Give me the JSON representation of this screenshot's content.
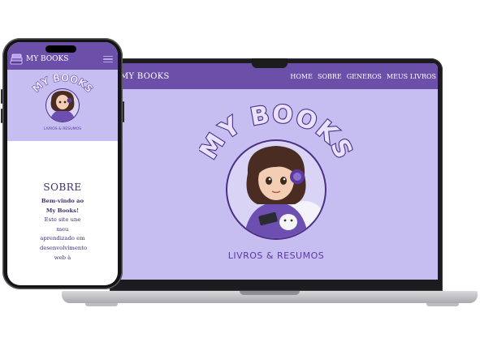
{
  "laptop": {
    "nav": {
      "brand": "MY BOOKS",
      "links": [
        "HOME",
        "SOBRE",
        "GENEROS",
        "MEUS LIVROS"
      ]
    },
    "hero": {
      "logo_title": "MY BOOKS",
      "logo_subtitle": "LIVROS & RESUMOS"
    }
  },
  "phone": {
    "nav": {
      "brand": "MY BOOKS",
      "menu_icon": "hamburger-menu-icon"
    },
    "hero": {
      "logo_title": "MY BOOKS",
      "logo_subtitle": "LIVROS & RESUMOS"
    },
    "about": {
      "title": "SOBRE",
      "text_bold": "Bem-vindo ao My Books!",
      "text": "Este site une meu aprendizado em desenvolvimento web à"
    }
  },
  "colors": {
    "nav_purple": "#6b4fa8",
    "hero_lavender": "#c6bdf0",
    "logo_text": "#e8e2ff",
    "logo_outline": "#4b2f85",
    "subtitle": "#5b3aa0"
  }
}
